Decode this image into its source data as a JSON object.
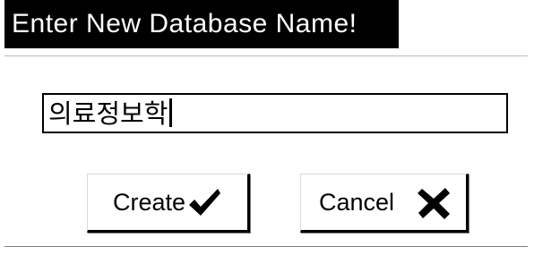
{
  "dialog": {
    "title": "Enter New Database Name!",
    "name_field": {
      "value": "의료정보학"
    },
    "buttons": {
      "create_label": "Create",
      "create_icon": "checkmark-icon",
      "cancel_label": "Cancel",
      "cancel_icon": "x-icon"
    }
  },
  "colors": {
    "titlebar_bg": "#000000",
    "title_text": "#ffffff",
    "dialog_bg": "#ffffff"
  }
}
